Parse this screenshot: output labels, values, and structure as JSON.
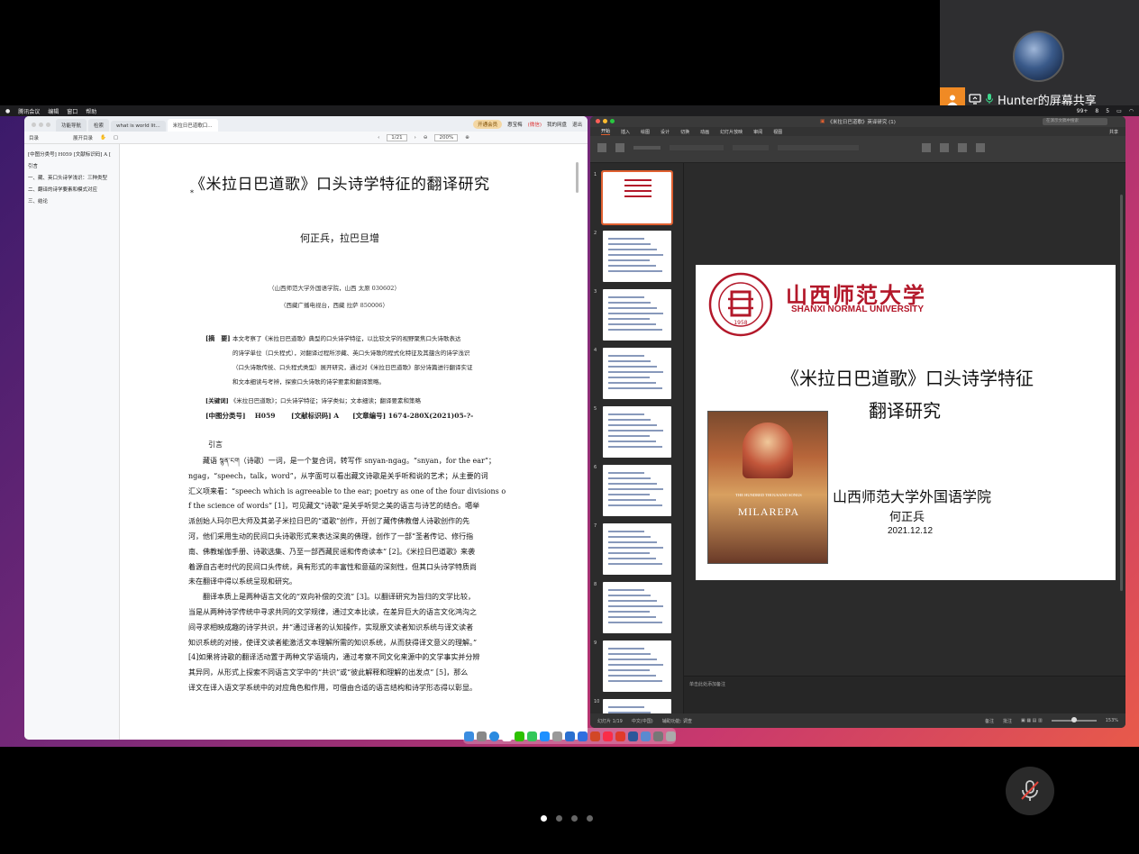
{
  "meeting": {
    "share_label": "Hunter的屏幕共享",
    "page_dots_count": 4,
    "active_dot": 0
  },
  "macos_menubar": {
    "items": [
      "腾讯会议",
      "编辑",
      "窗口",
      "帮助"
    ],
    "status": [
      "99+",
      "8",
      "5"
    ]
  },
  "pdf_reader": {
    "tabs": [
      "功能导航",
      "检索",
      "what is world lit...",
      "米拉日巴道歌口..."
    ],
    "right_controls": {
      "upgrade": "开通会员",
      "user": "惠宝梅",
      "user_tag": "(微信)",
      "my_docs": "我的网盘",
      "exit": "退出"
    },
    "toolbar": {
      "outline_label": "目录",
      "page_indicator": "1/21",
      "zoom": "200%"
    },
    "outline": {
      "header": "展开目录",
      "items": [
        "[中图分类号] H059 [文献标识码] A [",
        "引言",
        "一、藏、英口头诗学浅识：三种类型",
        "二、翻译的诗学要素和模式对应",
        "三、结论"
      ]
    },
    "page": {
      "title": "《米拉日巴道歌》口头诗学特征的翻译研究",
      "title_marker": "*",
      "authors": "何正兵，拉巴旦增",
      "affiliation_1": "（山西师范大学外国语学院，山西  太原  030602）",
      "affiliation_2": "（西藏广播电视台，西藏  拉萨  850006）",
      "abstract_label": "[摘　要]",
      "abstract_lines": [
        "本文考察了《米拉日巴道歌》典型的口头诗学特征，以比较文学的视野聚焦口头诗歌表达",
        "的诗学单位（口头程式），对翻译过程所涉藏、英口头诗歌的程式化特征及其蕴含的诗学浅识",
        "（口头诗歌传统、口头程式类型）展开研究，通过对《米拉日巴道歌》部分诗篇进行翻译实证",
        "和文本细读与考辨，探索口头诗歌的诗学要素和翻译策略。"
      ],
      "keywords_label": "[关键词]",
      "keywords": "《米拉日巴道歌》；口头诗学特征；诗学类似；文本细读；翻译要素和策略",
      "classification": "[中图分类号]　 H059　　 [文献标识码] A　　[文章编号] 1674-280X(2021)05-?-",
      "intro_heading": "引言",
      "body_lines": [
        "藏语 སྙན་ངག（诗歌）一词，是一个复合词，转写作 snyan-ngag。“snyan，for the ear”；",
        "ngag，“speech，talk，word”，从字面可以看出藏文诗歌是关乎听和说的艺术；从主要的词",
        "汇义项来看：“speech which is agreeable to the ear; poetry as one of the four divisions o",
        "f the science of words” [1]，可见藏文“诗歌”是关乎听觉之美的语言与诗艺的结合。噶举",
        "派创始人玛尔巴大师及其弟子米拉日巴的“道歌”创作，开创了藏传佛教僧人诗歌创作的先",
        "河，他们采用生动的民间口头诗歌形式来表达深奥的佛理，创作了一部“圣者传记、修行指",
        "南、佛教瑜伽手册、诗歌选集、乃至一部西藏民谣和传奇读本” [2]。《米拉日巴道歌》来袭",
        "着源自古老时代的民间口头传统，具有形式的丰富性和意蕴的深刻性，但其口头诗学特质尚",
        "未在翻译中得以系统呈现和研究。",
        "　　翻译本质上是两种语言文化的“双向补偿的交流” [3]。以翻译研究为旨归的文学比较，",
        "当是从两种诗学传统中寻求共同的文学规律，通过文本比读，在差异巨大的语言文化鸿沟之",
        "间寻求相映成趣的诗学共识，并“通过译者的认知操作，实现原文读者知识系统与译文读者",
        "知识系统的对接，使译文读者能激活文本理解所需的知识系统，从而获得译文意义的理解。”",
        "[4]如果将诗歌的翻译活动置于两种文学语境内，通过考察不同文化来源中的文学事实并分辨",
        "其异同，从形式上探索不同语言文学中的“共识”或“彼此解释和理解的出发点” [5]，那么",
        "译文在译入语文学系统中的对应角色和作用，可借由合适的语言结构和诗学形态得以彰显。"
      ]
    }
  },
  "powerpoint": {
    "window_title": "《米拉日巴道歌》英译研究 (1)",
    "search_placeholder": "在演示文稿中搜索",
    "share_label": "共享",
    "ribbon_tabs": [
      "开始",
      "插入",
      "绘图",
      "设计",
      "切换",
      "动画",
      "幻灯片放映",
      "审阅",
      "视图"
    ],
    "slide_numbers": [
      "1",
      "2",
      "3",
      "4",
      "5",
      "6",
      "7",
      "8",
      "9",
      "10"
    ],
    "slide": {
      "logo_cn": "山西师范大学",
      "logo_en": "SHANXI NORMAL UNIVERSITY",
      "seal_year": "1958",
      "title_line1": "《米拉日巴道歌》口头诗学特征",
      "title_line2": "翻译研究",
      "book_title": "MILAREPA",
      "book_subtitle": "THE HUNDRED THOUSAND SONGS",
      "institution": "山西师范大学外国语学院",
      "presenter": "何正兵",
      "date": "2021.12.12"
    },
    "notes_placeholder": "单击此处添加备注",
    "status": {
      "slide_count": "幻灯片 1/19",
      "language": "中文(中国)",
      "accessibility": "辅助功能: 调查",
      "notes": "备注",
      "comments": "批注",
      "zoom": "153%"
    }
  },
  "colors": {
    "ppt_accent": "#e06030",
    "logo_red": "#b3182a",
    "meeting_orange": "#f08a24"
  }
}
